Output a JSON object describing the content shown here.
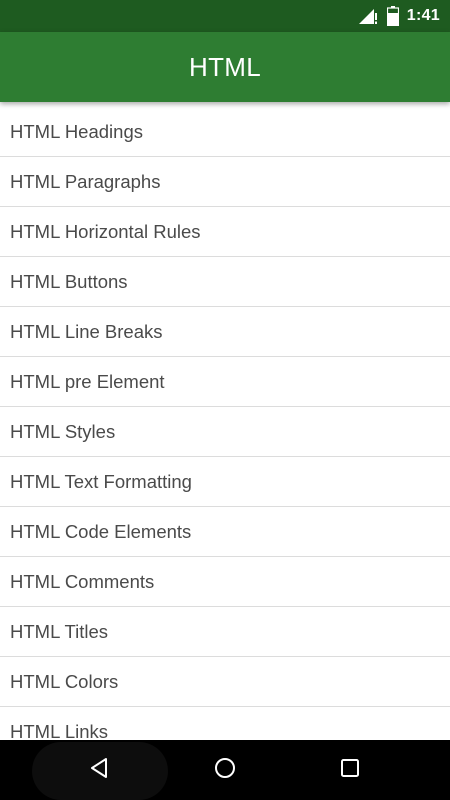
{
  "status_bar": {
    "time": "1:41",
    "icons": [
      "signal-icon",
      "battery-icon"
    ]
  },
  "app_bar": {
    "title": "HTML"
  },
  "list": {
    "items": [
      "HTML Headings",
      "HTML Paragraphs",
      "HTML Horizontal Rules",
      "HTML Buttons",
      "HTML Line Breaks",
      "HTML pre Element",
      "HTML Styles",
      "HTML Text Formatting",
      "HTML Code Elements",
      "HTML Comments",
      "HTML Titles",
      "HTML Colors",
      "HTML Links"
    ]
  },
  "nav_bar": {
    "icons": [
      "back-icon",
      "home-icon",
      "recents-icon"
    ]
  },
  "colors": {
    "status_bar": "#1e5b20",
    "app_bar": "#2e7d32",
    "list_text": "#4a4a4a",
    "divider": "#dcdcdc",
    "nav_bar": "#000000"
  }
}
